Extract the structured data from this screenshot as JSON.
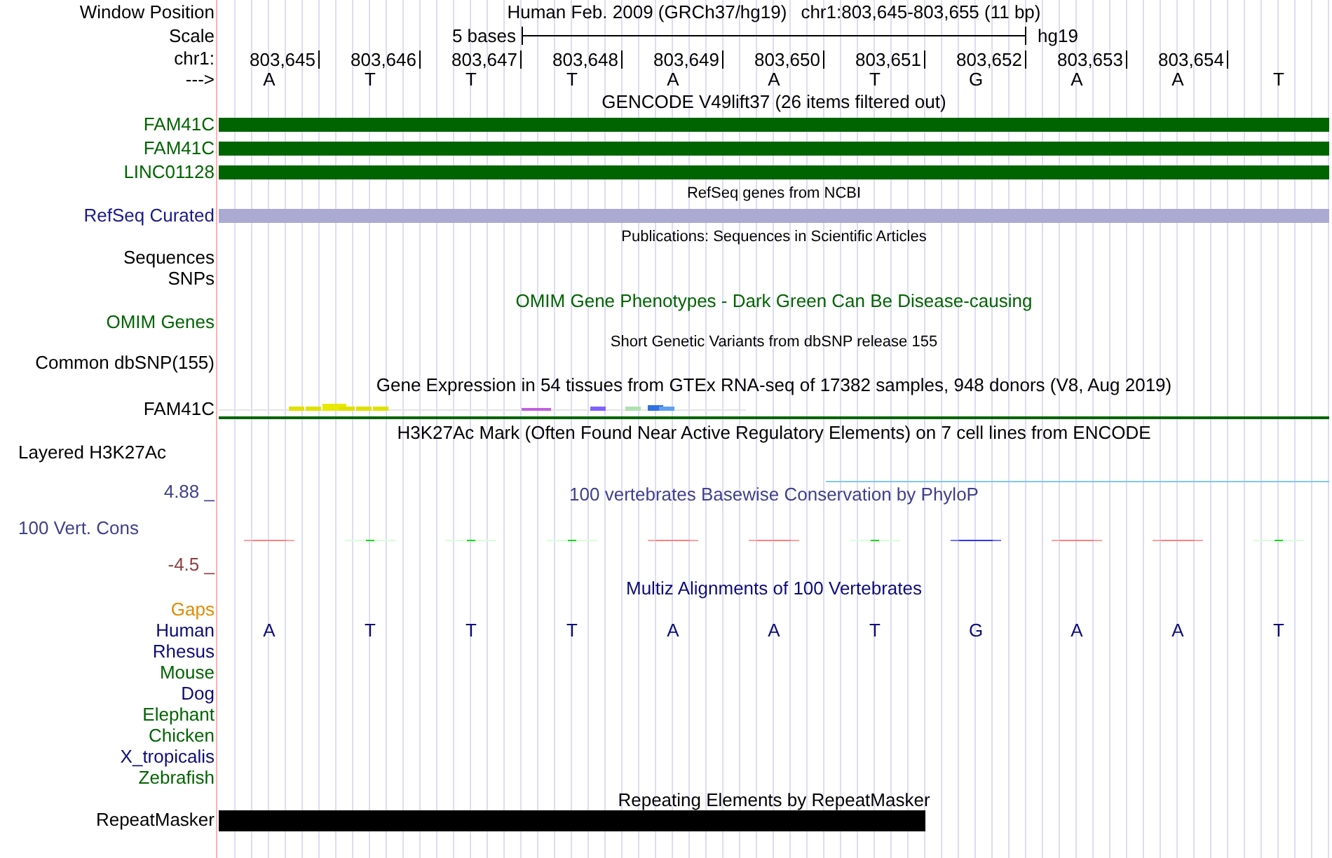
{
  "header": {
    "label": "Window Position",
    "title": "Human Feb. 2009 (GRCh37/hg19)",
    "position": "chr1:803,645-803,655 (11 bp)"
  },
  "scale": {
    "label": "Scale",
    "length": "5 bases",
    "assembly": "hg19"
  },
  "ruler": {
    "label": "chr1:",
    "ticks": [
      "803,645",
      "803,646",
      "803,647",
      "803,648",
      "803,649",
      "803,650",
      "803,651",
      "803,652",
      "803,653",
      "803,654"
    ]
  },
  "strand": {
    "label": "--->",
    "bases": [
      "A",
      "T",
      "T",
      "T",
      "A",
      "A",
      "T",
      "G",
      "A",
      "A",
      "T"
    ]
  },
  "rows": [
    {
      "kind": "title",
      "text": "GENCODE V49lift37 (26 items filtered out)",
      "color": "#000000"
    },
    {
      "kind": "bar",
      "label": "FAM41C",
      "color": "#006400"
    },
    {
      "kind": "bar",
      "label": "FAM41C",
      "color": "#006400"
    },
    {
      "kind": "bar",
      "label": "LINC01128",
      "color": "#006400"
    },
    {
      "kind": "subtitle",
      "text": "RefSeq genes from NCBI",
      "color": "#000000"
    },
    {
      "kind": "curated",
      "label": "RefSeq Curated",
      "color": "#1a1a8c"
    },
    {
      "kind": "subtitle",
      "text": "Publications: Sequences in Scientific Articles",
      "color": "#000000"
    },
    {
      "kind": "label",
      "label": "Sequences",
      "color": "#000000"
    },
    {
      "kind": "label",
      "label": "SNPs",
      "color": "#000000"
    },
    {
      "kind": "title",
      "text": "OMIM Gene Phenotypes - Dark Green Can Be Disease-causing",
      "color": "#006400"
    },
    {
      "kind": "label",
      "label": "OMIM Genes",
      "color": "#006400"
    },
    {
      "kind": "subtitle",
      "text": "Short Genetic Variants from dbSNP release 155",
      "color": "#000000"
    },
    {
      "kind": "label",
      "label": "Common dbSNP(155)",
      "color": "#000000"
    },
    {
      "kind": "title",
      "text": "Gene Expression in 54 tissues from GTEx RNA-seq of 17382 samples, 948 donors (V8, Aug 2019)",
      "color": "#000000"
    },
    {
      "kind": "expression",
      "label": "FAM41C",
      "color": "#000000"
    },
    {
      "kind": "title",
      "text": "H3K27Ac Mark (Often Found Near Active Regulatory Elements) on 7 cell lines from ENCODE",
      "color": "#000000"
    },
    {
      "kind": "group",
      "label": "Layered H3K27Ac",
      "color": "#000000"
    },
    {
      "kind": "wiggle",
      "label": "100 Vert. Cons",
      "color": "#40408c",
      "upper": "4.88 _",
      "lower": "-4.5 _",
      "title": "100 vertebrates Basewise Conservation by PhyloP"
    },
    {
      "kind": "title",
      "text": "Multiz Alignments of 100 Vertebrates",
      "color": "#0c0c78"
    },
    {
      "kind": "label",
      "label": "Gaps",
      "color": "#e08c00"
    },
    {
      "kind": "bases",
      "label": "Human",
      "color": "#0c0c78",
      "bases": [
        "A",
        "T",
        "T",
        "T",
        "A",
        "A",
        "T",
        "G",
        "A",
        "A",
        "T"
      ]
    },
    {
      "kind": "label",
      "label": "Rhesus",
      "color": "#0c0c78"
    },
    {
      "kind": "label",
      "label": "Mouse",
      "color": "#006400"
    },
    {
      "kind": "label",
      "label": "Dog",
      "color": "#0c0c78"
    },
    {
      "kind": "label",
      "label": "Elephant",
      "color": "#006400"
    },
    {
      "kind": "label",
      "label": "Chicken",
      "color": "#006400"
    },
    {
      "kind": "label",
      "label": "X_tropicalis",
      "color": "#0c0c78"
    },
    {
      "kind": "label",
      "label": "Zebrafish",
      "color": "#006400"
    },
    {
      "kind": "repeat",
      "label": "RepeatMasker",
      "color": "#000000",
      "title": "Repeating Elements by RepeatMasker"
    }
  ]
}
